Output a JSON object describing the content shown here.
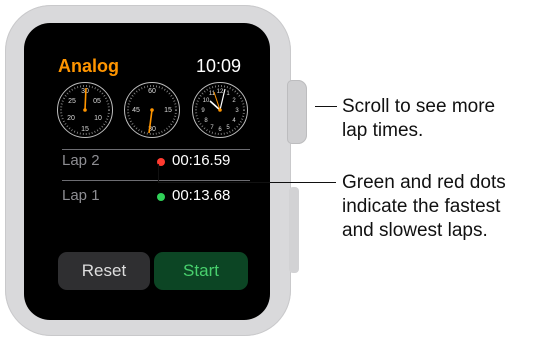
{
  "watch": {
    "title": "Analog",
    "time": "10:09",
    "dials": [
      {
        "labels": [
          "30",
          "05",
          "25",
          "20",
          "10",
          "15"
        ]
      },
      {
        "labels": [
          "60",
          "45",
          "15",
          "30"
        ]
      },
      {
        "labels": [
          "12",
          "1",
          "2",
          "11",
          "10",
          "3",
          "9",
          "7",
          "6",
          "5",
          "4",
          "8"
        ]
      }
    ],
    "laps": [
      {
        "label": "Lap 2",
        "time": "00:16.59",
        "dot_color": "#ff3b30"
      },
      {
        "label": "Lap 1",
        "time": "00:13.68",
        "dot_color": "#30d158"
      }
    ],
    "buttons": {
      "reset": "Reset",
      "start": "Start"
    }
  },
  "callouts": {
    "scroll_line1": "Scroll to see more",
    "scroll_line2": "lap times.",
    "dots_line1": "Green and red dots",
    "dots_line2": "indicate the fastest",
    "dots_line3": "and slowest laps."
  },
  "colors": {
    "accent_orange": "#ff9500",
    "slowest_red": "#ff3b30",
    "fastest_green": "#30d158",
    "start_text": "#48d06d",
    "start_bg": "#0c4524"
  }
}
